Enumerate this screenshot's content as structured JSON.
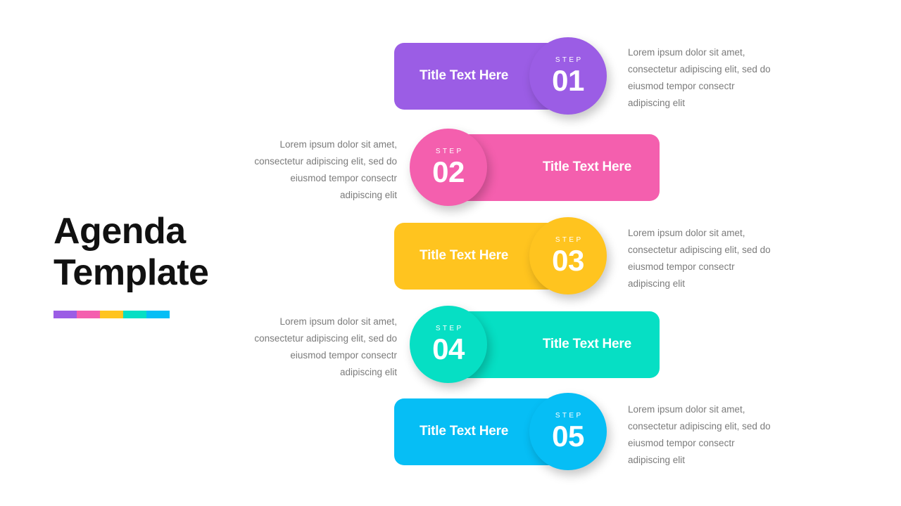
{
  "slide": {
    "title": "Agenda\nTemplate",
    "accent_colors": [
      "#9B5DE5",
      "#F45FAE",
      "#FFC41F",
      "#06DFC4",
      "#06BEF5"
    ]
  },
  "steps": [
    {
      "step_label": "STEP",
      "number": "01",
      "title": "Title Text Here",
      "color": "#9B5DE5",
      "description": "Lorem ipsum dolor sit amet, consectetur adipiscing elit, sed do eiusmod tempor consectr adipiscing elit",
      "layout": "bar-left",
      "text_side": "right"
    },
    {
      "step_label": "STEP",
      "number": "02",
      "title": "Title Text Here",
      "color": "#F45FAE",
      "description": "Lorem ipsum dolor sit amet, consectetur adipiscing elit, sed do eiusmod tempor consectr adipiscing elit",
      "layout": "bar-right",
      "text_side": "left"
    },
    {
      "step_label": "STEP",
      "number": "03",
      "title": "Title Text Here",
      "color": "#FFC41F",
      "description": "Lorem ipsum dolor sit amet, consectetur adipiscing elit, sed do eiusmod tempor consectr adipiscing elit",
      "layout": "bar-left",
      "text_side": "right"
    },
    {
      "step_label": "STEP",
      "number": "04",
      "title": "Title Text Here",
      "color": "#06DFC4",
      "description": "Lorem ipsum dolor sit amet, consectetur adipiscing elit, sed do eiusmod tempor consectr adipiscing elit",
      "layout": "bar-right",
      "text_side": "left"
    },
    {
      "step_label": "STEP",
      "number": "05",
      "title": "Title Text Here",
      "color": "#06BEF5",
      "description": "Lorem ipsum dolor sit amet, consectetur adipiscing elit, sed do eiusmod tempor consectr adipiscing elit",
      "layout": "bar-left",
      "text_side": "right"
    }
  ]
}
